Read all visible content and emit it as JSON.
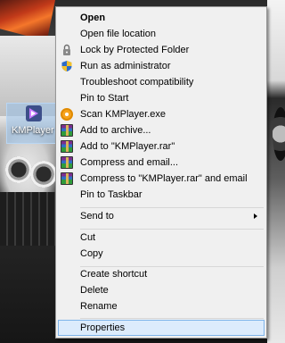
{
  "desktop_icon": {
    "label": "KMPlayer"
  },
  "context_menu": {
    "items": [
      {
        "label": "Open",
        "bold": true
      },
      {
        "label": "Open file location"
      },
      {
        "label": "Lock by Protected Folder",
        "icon": "lock-icon"
      },
      {
        "label": "Run as administrator",
        "icon": "shield-icon"
      },
      {
        "label": "Troubleshoot compatibility"
      },
      {
        "label": "Pin to Start"
      },
      {
        "label": "Scan KMPlayer.exe",
        "icon": "antivirus-icon"
      },
      {
        "label": "Add to archive...",
        "icon": "winrar-icon"
      },
      {
        "label": "Add to \"KMPlayer.rar\"",
        "icon": "winrar-icon"
      },
      {
        "label": "Compress and email...",
        "icon": "winrar-icon"
      },
      {
        "label": "Compress to \"KMPlayer.rar\" and email",
        "icon": "winrar-icon"
      },
      {
        "label": "Pin to Taskbar"
      },
      {
        "label": "Send to",
        "submenu": true
      },
      {
        "label": "Cut"
      },
      {
        "label": "Copy"
      },
      {
        "label": "Create shortcut"
      },
      {
        "label": "Delete"
      },
      {
        "label": "Rename"
      },
      {
        "label": "Properties",
        "highlighted": true
      }
    ]
  },
  "colors": {
    "menu_background": "#f0f0f0",
    "highlight": "#dcebfc",
    "highlight_border": "#7eb4ea",
    "icon_selection": "#9ac2eb"
  }
}
